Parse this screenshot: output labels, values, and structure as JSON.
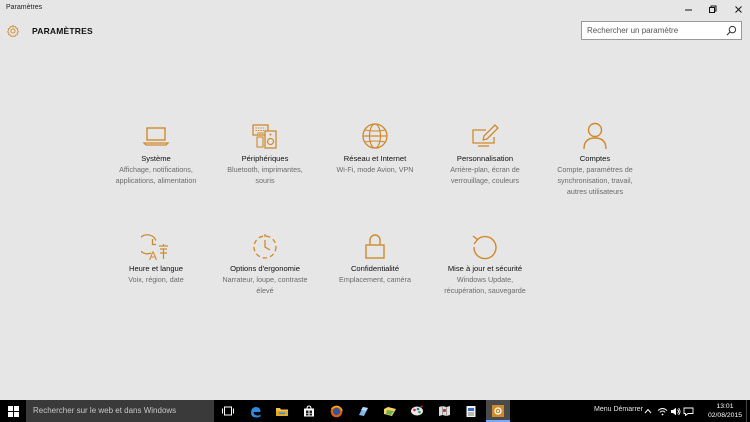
{
  "window": {
    "title": "Paramètres",
    "controls": [
      "minimize-icon",
      "maximize-icon",
      "close-icon"
    ]
  },
  "header": {
    "icon": "gear-icon",
    "title": "PARAMÈTRES",
    "search_placeholder": "Rechercher un paramètre"
  },
  "accent_color": "#d08a2e",
  "categories": [
    {
      "icon": "laptop-icon",
      "name": "Système",
      "description": "Affichage, notifications, applications, alimentation"
    },
    {
      "icon": "keyboard-speaker-icon",
      "name": "Périphériques",
      "description": "Bluetooth, imprimantes, souris"
    },
    {
      "icon": "globe-icon",
      "name": "Réseau et Internet",
      "description": "Wi-Fi, mode Avion, VPN"
    },
    {
      "icon": "paint-pen-icon",
      "name": "Personnalisation",
      "description": "Arrière-plan, écran de verrouillage, couleurs"
    },
    {
      "icon": "person-icon",
      "name": "Comptes",
      "description": "Compte, paramètres de synchronisation, travail, autres utilisateurs"
    },
    {
      "icon": "clock-language-icon",
      "name": "Heure et langue",
      "description": "Voix, région, date"
    },
    {
      "icon": "ease-of-access-icon",
      "name": "Options d'ergonomie",
      "description": "Narrateur, loupe, contraste élevé"
    },
    {
      "icon": "lock-icon",
      "name": "Confidentialité",
      "description": "Emplacement, caméra"
    },
    {
      "icon": "update-arrow-icon",
      "name": "Mise à jour et sécurité",
      "description": "Windows Update, récupération, sauvegarde"
    }
  ],
  "taskbar": {
    "search_text": "Rechercher sur le web et dans Windows",
    "apps": [
      "task-view-icon",
      "edge-icon",
      "file-explorer-icon",
      "store-icon",
      "firefox-icon",
      "app-icon",
      "folder-app-icon",
      "paint-icon",
      "map-icon",
      "document-icon",
      "settings-icon"
    ],
    "menu_label": "Menu Démarrer",
    "tray_icons": [
      "chevron-up-icon",
      "wifi-icon",
      "volume-icon",
      "message-icon"
    ],
    "time": "13:01",
    "date": "02/08/2015"
  }
}
